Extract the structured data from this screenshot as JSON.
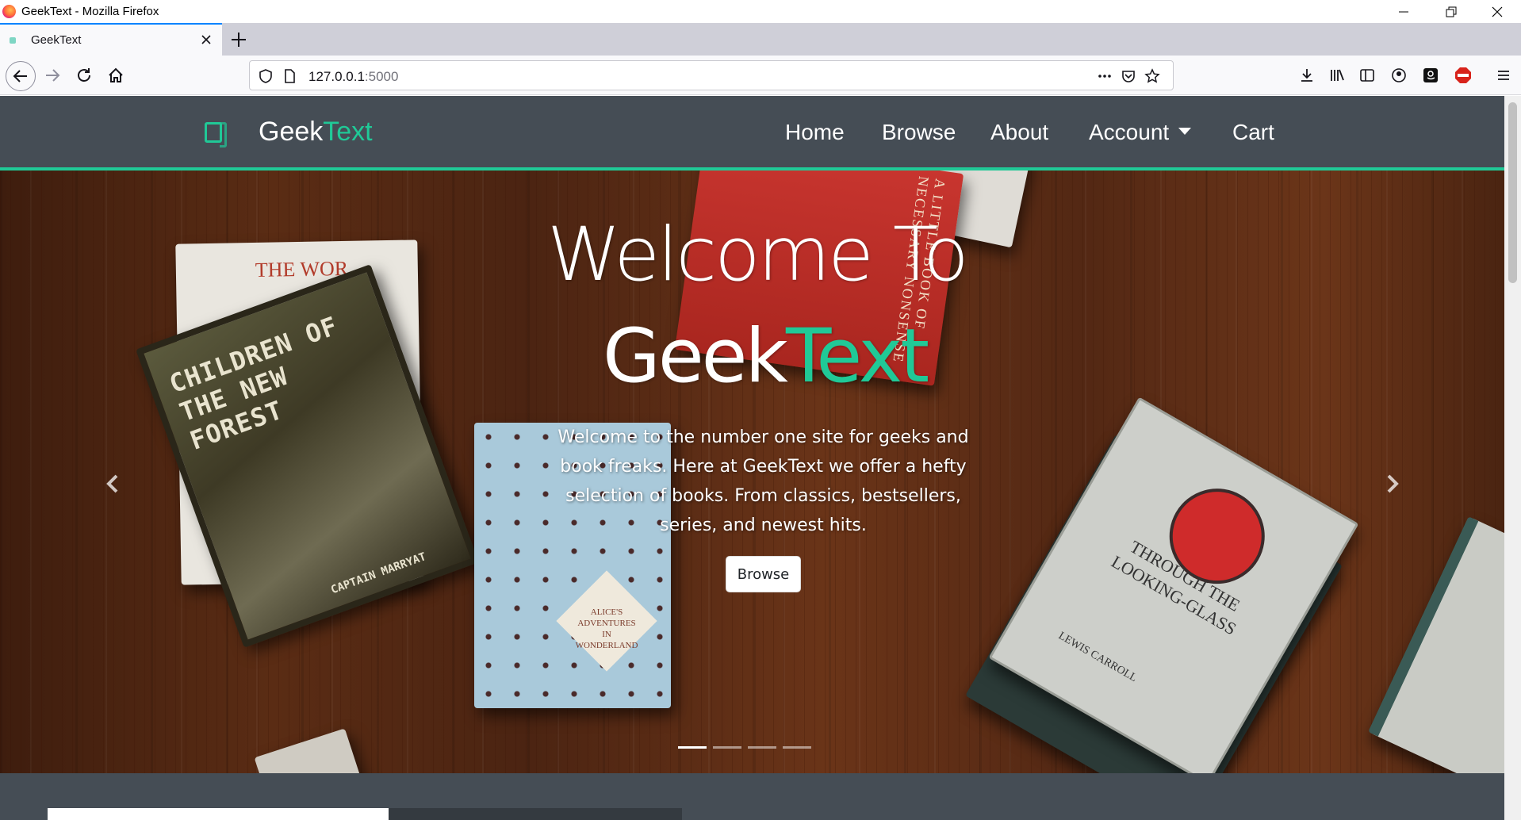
{
  "browser": {
    "window_title": "GeekText - Mozilla Firefox",
    "tab_title": "GeekText",
    "url_host": "127.0.0.1",
    "url_port": ":5000"
  },
  "site": {
    "brand_prefix": "Geek",
    "brand_suffix": "Text",
    "accent_color": "#20c997",
    "nav": {
      "home": "Home",
      "browse": "Browse",
      "about": "About",
      "account": "Account",
      "cart": "Cart"
    }
  },
  "hero": {
    "heading_line1": "Welcome To",
    "heading_geek": "Geek",
    "heading_text": "Text",
    "lead": "Welcome to the number one site for geeks and book freaks. Here at GeekText we offer a hefty selection of books. From classics, bestsellers, series, and newest hits.",
    "button": "Browse",
    "slides": 4,
    "active_slide": 1,
    "image_text": {
      "book1_title": "THE WOR",
      "book2_title": "CHILDREN OF THE NEW FOREST",
      "book2_author": "CAPTAIN MARRYAT",
      "book3_spine": "A LITTLE BOOK OF NECESSARY NONSENSE",
      "book4_title": "ALICE'S ADVENTURES IN WONDERLAND",
      "book6_title": "THROUGH THE LOOKING-GLASS",
      "book6_author": "LEWIS CARROLL"
    }
  }
}
